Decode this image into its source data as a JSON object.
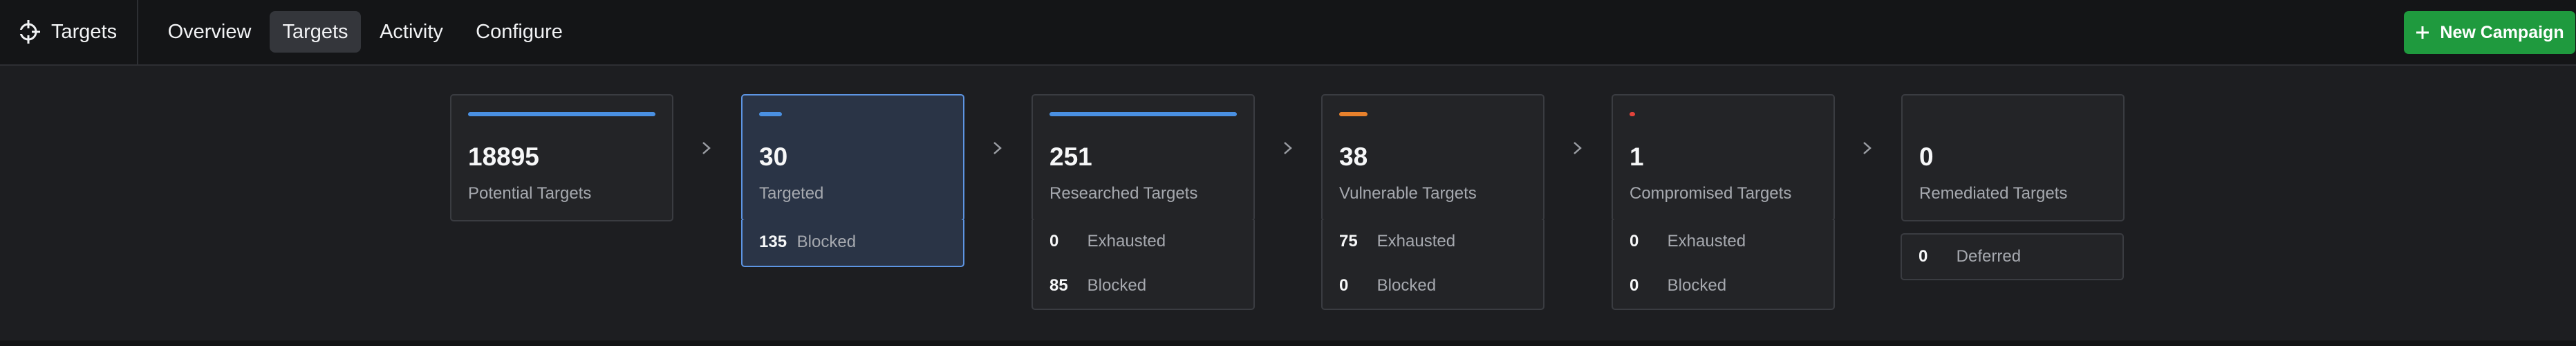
{
  "app": {
    "title": "Targets",
    "icon": "target-crosshair-icon"
  },
  "nav": {
    "tabs": [
      {
        "label": "Overview",
        "active": false
      },
      {
        "label": "Targets",
        "active": true
      },
      {
        "label": "Activity",
        "active": false
      },
      {
        "label": "Configure",
        "active": false
      }
    ]
  },
  "actions": {
    "new_campaign_label": "New Campaign",
    "new_campaign_icon": "plus-icon",
    "new_campaign_color": "#1f9a3e"
  },
  "pipeline": {
    "stages": [
      {
        "count": "18895",
        "label": "Potential Targets",
        "bar_color": "#4a90e2",
        "bar_fraction": 1.0,
        "selected": false,
        "sub": []
      },
      {
        "count": "30",
        "label": "Targeted",
        "bar_color": "#4a90e2",
        "bar_fraction": 0.12,
        "selected": true,
        "sub": [
          {
            "num": "135",
            "label": "Blocked"
          }
        ]
      },
      {
        "count": "251",
        "label": "Researched Targets",
        "bar_color": "#4a90e2",
        "bar_fraction": 1.0,
        "selected": false,
        "sub": [
          {
            "num": "0",
            "label": "Exhausted"
          },
          {
            "num": "85",
            "label": "Blocked"
          }
        ]
      },
      {
        "count": "38",
        "label": "Vulnerable Targets",
        "bar_color": "#e8812c",
        "bar_fraction": 0.15,
        "selected": false,
        "sub": [
          {
            "num": "75",
            "label": "Exhausted"
          },
          {
            "num": "0",
            "label": "Blocked"
          }
        ]
      },
      {
        "count": "1",
        "label": "Compromised Targets",
        "bar_color": "#e2433b",
        "bar_fraction": 0.03,
        "selected": false,
        "sub": [
          {
            "num": "0",
            "label": "Exhausted"
          },
          {
            "num": "0",
            "label": "Blocked"
          }
        ]
      },
      {
        "count": "0",
        "label": "Remediated Targets",
        "bar_color": "",
        "bar_fraction": 0,
        "selected": false,
        "sub": [
          {
            "num": "0",
            "label": "Deferred"
          }
        ]
      }
    ]
  }
}
